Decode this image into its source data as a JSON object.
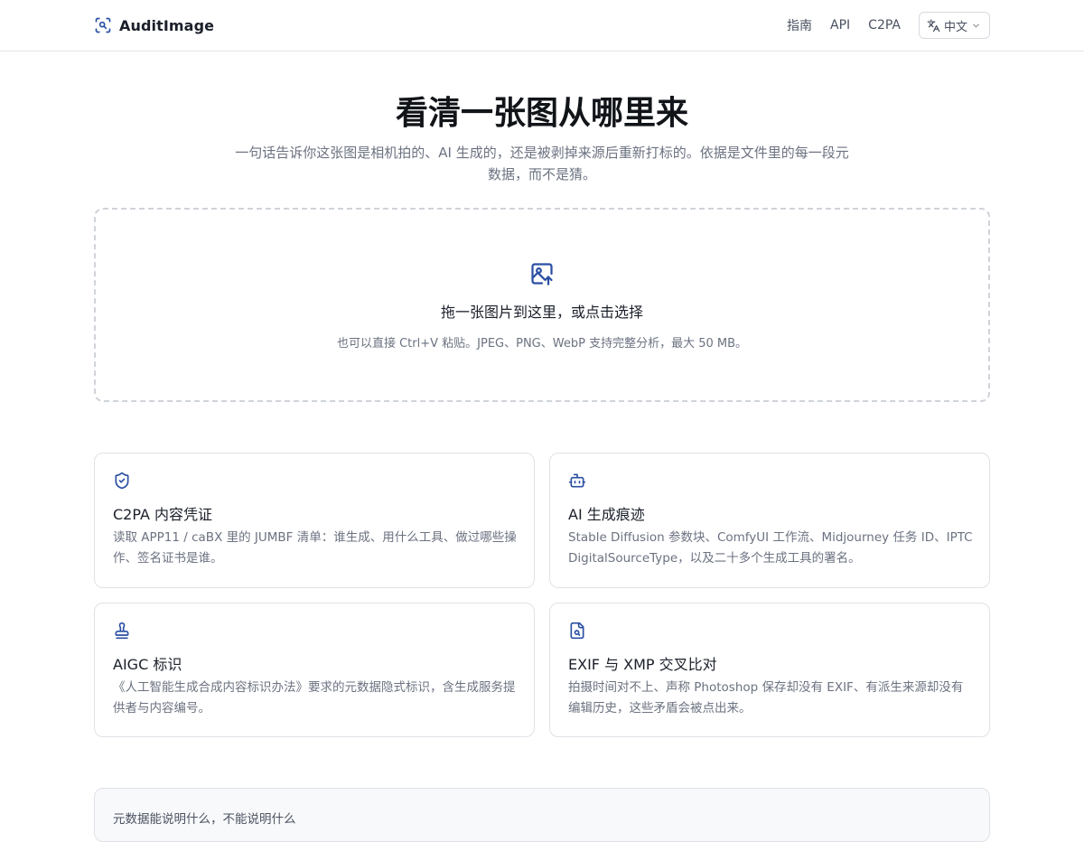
{
  "header": {
    "brand": "AuditImage",
    "nav": [
      "指南",
      "API",
      "C2PA"
    ],
    "language": "中文",
    "icons": {
      "logo": "scan-search-icon",
      "language": "translate-icon",
      "dropdown": "chevron-down-icon"
    }
  },
  "hero": {
    "title": "看清一张图从哪里来",
    "subtitle": "一句话告诉你这张图是相机拍的、AI 生成的，还是被剥掉来源后重新打标的。依据是文件里的每一段元数据，而不是猜。"
  },
  "dropzone": {
    "icon": "image-upload-icon",
    "title": "拖一张图片到这里，或点击选择",
    "hint": "也可以直接 Ctrl+V 粘贴。JPEG、PNG、WebP 支持完整分析，最大 50 MB。"
  },
  "features": [
    {
      "icon": "shield-check-icon",
      "title": "C2PA 内容凭证",
      "desc": "读取 APP11 / caBX 里的 JUMBF 清单：谁生成、用什么工具、做过哪些操作、签名证书是谁。"
    },
    {
      "icon": "bot-icon",
      "title": "AI 生成痕迹",
      "desc": "Stable Diffusion 参数块、ComfyUI 工作流、Midjourney 任务 ID、IPTC DigitalSourceType，以及二十多个生成工具的署名。"
    },
    {
      "icon": "stamp-icon",
      "title": "AIGC 标识",
      "desc": "《人工智能生成合成内容标识办法》要求的元数据隐式标识，含生成服务提供者与内容编号。"
    },
    {
      "icon": "file-search-icon",
      "title": "EXIF 与 XMP 交叉比对",
      "desc": "拍摄时间对不上、声称 Photoshop 保存却没有 EXIF、有派生来源却没有编辑历史，这些矛盾会被点出来。"
    }
  ],
  "footer_panel": {
    "text": "元数据能说明什么，不能说明什么"
  },
  "colors": {
    "accent": "#2b4fa3",
    "text": "#1a1f29",
    "muted": "#6b7280",
    "border": "#dfe2e7"
  }
}
